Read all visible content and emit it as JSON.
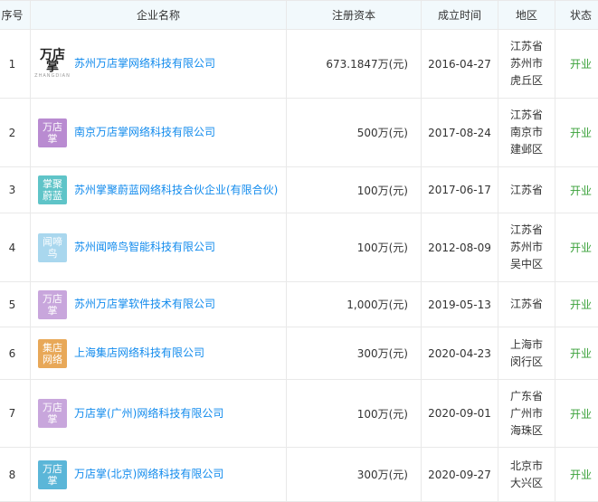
{
  "headers": {
    "index": "序号",
    "name": "企业名称",
    "capital": "注册资本",
    "date": "成立时间",
    "region": "地区",
    "status": "状态"
  },
  "rows": [
    {
      "index": "1",
      "logo_type": "image",
      "logo_text": "万店掌",
      "logo_subtext": "ZHANGDIAN",
      "logo_color": "#ffffff",
      "name": "苏州万店掌网络科技有限公司",
      "capital": "673.1847万(元)",
      "date": "2016-04-27",
      "region": "江苏省\n苏州市\n虎丘区",
      "status": "开业"
    },
    {
      "index": "2",
      "logo_type": "text",
      "logo_text": "万店\n掌",
      "logo_color": "#b98bd1",
      "name": "南京万店掌网络科技有限公司",
      "capital": "500万(元)",
      "date": "2017-08-24",
      "region": "江苏省\n南京市\n建邺区",
      "status": "开业"
    },
    {
      "index": "3",
      "logo_type": "text",
      "logo_text": "掌聚\n蔚蓝",
      "logo_color": "#5fc4c8",
      "name": "苏州掌聚蔚蓝网络科技合伙企业(有限合伙)",
      "capital": "100万(元)",
      "date": "2017-06-17",
      "region": "江苏省",
      "status": "开业"
    },
    {
      "index": "4",
      "logo_type": "text",
      "logo_text": "闻啼\n鸟",
      "logo_color": "#a9d7ee",
      "name": "苏州闻啼鸟智能科技有限公司",
      "capital": "100万(元)",
      "date": "2012-08-09",
      "region": "江苏省\n苏州市\n吴中区",
      "status": "开业"
    },
    {
      "index": "5",
      "logo_type": "text",
      "logo_text": "万店\n掌",
      "logo_color": "#c8a6dc",
      "name": "苏州万店掌软件技术有限公司",
      "capital": "1,000万(元)",
      "date": "2019-05-13",
      "region": "江苏省",
      "status": "开业"
    },
    {
      "index": "6",
      "logo_type": "text",
      "logo_text": "集店\n网络",
      "logo_color": "#e8a858",
      "name": "上海集店网络科技有限公司",
      "capital": "300万(元)",
      "date": "2020-04-23",
      "region": "上海市\n闵行区",
      "status": "开业"
    },
    {
      "index": "7",
      "logo_type": "text",
      "logo_text": "万店\n掌",
      "logo_color": "#c8a6dc",
      "name": "万店掌(广州)网络科技有限公司",
      "capital": "100万(元)",
      "date": "2020-09-01",
      "region": "广东省\n广州市\n海珠区",
      "status": "开业"
    },
    {
      "index": "8",
      "logo_type": "text",
      "logo_text": "万店\n掌",
      "logo_color": "#5bb6d8",
      "name": "万店掌(北京)网络科技有限公司",
      "capital": "300万(元)",
      "date": "2020-09-27",
      "region": "北京市\n大兴区",
      "status": "开业"
    }
  ]
}
